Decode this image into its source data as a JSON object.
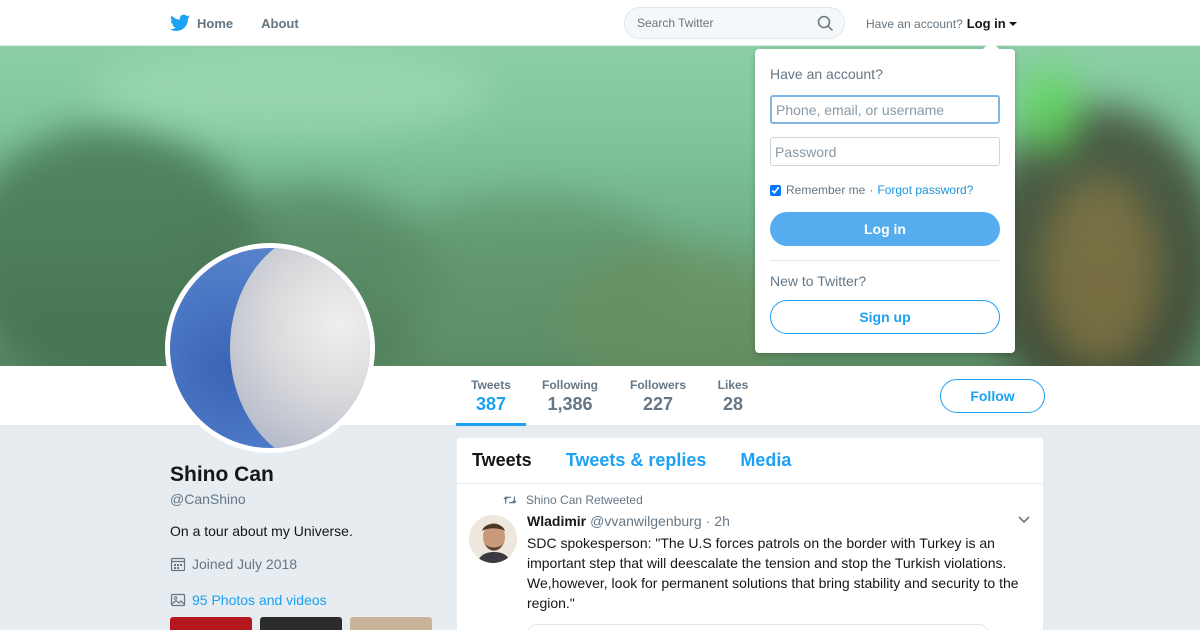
{
  "nav": {
    "home_label": "Home",
    "about_label": "About",
    "search_placeholder": "Search Twitter",
    "account_prompt": "Have an account?",
    "login_label": "Log in"
  },
  "profile": {
    "name": "Shino Can",
    "handle": "@CanShino",
    "bio": "On a tour about my Universe.",
    "joined": "Joined July 2018",
    "photos_link": "95 Photos and videos",
    "follow_label": "Follow"
  },
  "stats": [
    {
      "label": "Tweets",
      "value": "387",
      "active": true
    },
    {
      "label": "Following",
      "value": "1,386",
      "active": false
    },
    {
      "label": "Followers",
      "value": "227",
      "active": false
    },
    {
      "label": "Likes",
      "value": "28",
      "active": false
    }
  ],
  "timeline": {
    "tabs": [
      "Tweets",
      "Tweets & replies",
      "Media"
    ],
    "tweet": {
      "retweet_context": "Shino Can Retweeted",
      "author_name": "Wladimir",
      "author_handle": "@vvanwilgenburg",
      "time": "2h",
      "text": "SDC spokesperson: \"The U.S forces patrols on the border with Turkey is an important step that will deescalate the tension and stop the Turkish violations. We,however, look for permanent solutions that bring stability and security to the region.\""
    }
  },
  "login_dropdown": {
    "title": "Have an account?",
    "username_placeholder": "Phone, email, or username",
    "password_placeholder": "Password",
    "remember_label": "Remember me",
    "separator": "·",
    "forgot_label": "Forgot password?",
    "login_button": "Log in",
    "new_prompt": "New to Twitter?",
    "signup_button": "Sign up"
  },
  "colors": {
    "accent": "#1da1f2",
    "login_button": "#55acee"
  },
  "icons": [
    "twitter-bird-icon",
    "search-icon",
    "caret-down-icon",
    "calendar-icon",
    "photo-icon",
    "retweet-icon",
    "chevron-down-icon"
  ]
}
